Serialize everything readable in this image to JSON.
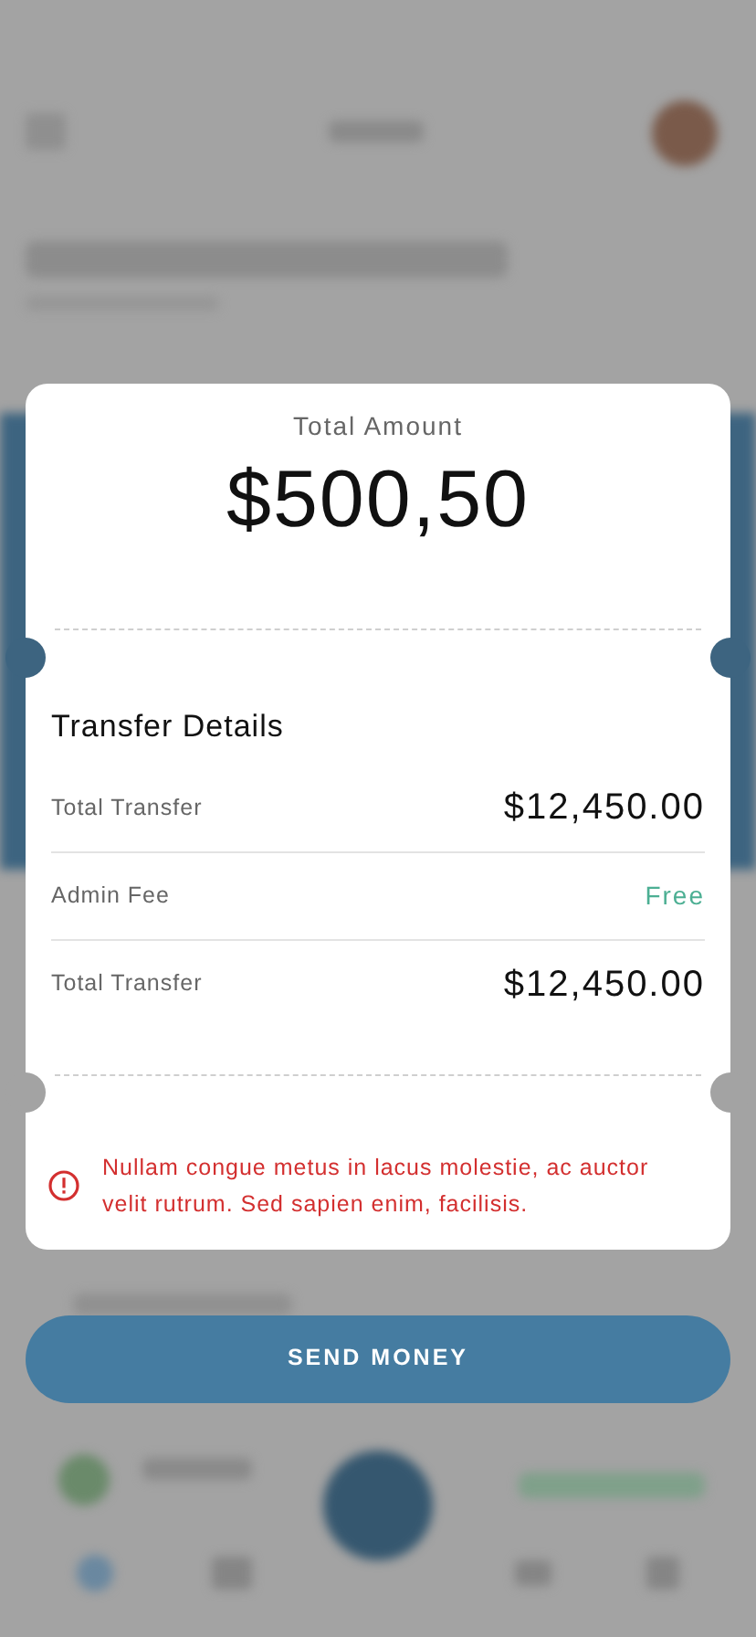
{
  "receipt": {
    "total_label": "Total Amount",
    "total_value": "$500,50",
    "details_title": "Transfer Details",
    "rows": [
      {
        "label": "Total Transfer",
        "value": "$12,450.00",
        "kind": "amount"
      },
      {
        "label": "Admin Fee",
        "value": "Free",
        "kind": "free"
      },
      {
        "label": "Total Transfer",
        "value": "$12,450.00",
        "kind": "amount"
      }
    ],
    "warning": "Nullam congue metus in lacus molestie, ac auctor velit rutrum. Sed sapien enim, facilisis."
  },
  "button": {
    "label": "SEND MONEY"
  }
}
